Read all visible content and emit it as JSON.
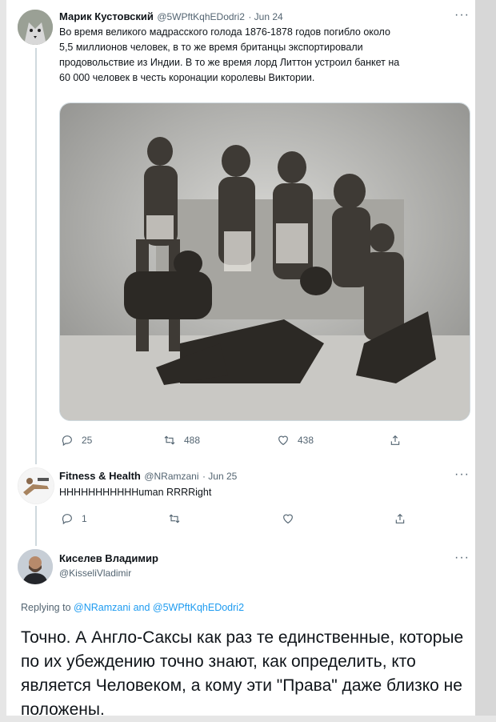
{
  "tweet1": {
    "author_name": "Марик Кустовский",
    "author_handle": "@5WPftKqhEDodri2",
    "date": "· Jun 24",
    "text_lines": [
      "Во время великого мадрасского голода 1876-1878 годов погибло около",
      "5,5 миллионов человек, в то же время британцы экспортировали",
      "продовольствие из Индии. В то же время лорд Литтон устроил банкет на",
      "60 000 человек в честь коронации королевы Виктории."
    ],
    "replies": "25",
    "retweets": "488",
    "likes": "438"
  },
  "tweet2": {
    "author_name": "Fitness & Health",
    "author_handle": "@NRamzani",
    "date": "· Jun 25",
    "text": "HHHHHHHHHHHuman RRRRight",
    "replies": "1",
    "retweets": "",
    "likes": ""
  },
  "tweet3": {
    "author_name": "Киселев Владимир",
    "author_handle": "@KisseliVladimir",
    "replying_prefix": "Replying to",
    "replying_mention1": "@NRamzani",
    "replying_and": "and",
    "replying_mention2": "@5WPftKqhEDodri2",
    "text": "Точно. А Англо-Саксы как раз те единственные, которые по их убеждению точно знают, как определить, кто является Человеком, а кому эти \"Права\" даже близко не положены."
  },
  "more_glyph": "···",
  "icons": [
    "reply-icon",
    "retweet-icon",
    "like-icon",
    "share-icon",
    "more-icon"
  ],
  "colors": {
    "accent": "#1d9bf0",
    "muted": "#536471",
    "border": "#cfd9de"
  }
}
